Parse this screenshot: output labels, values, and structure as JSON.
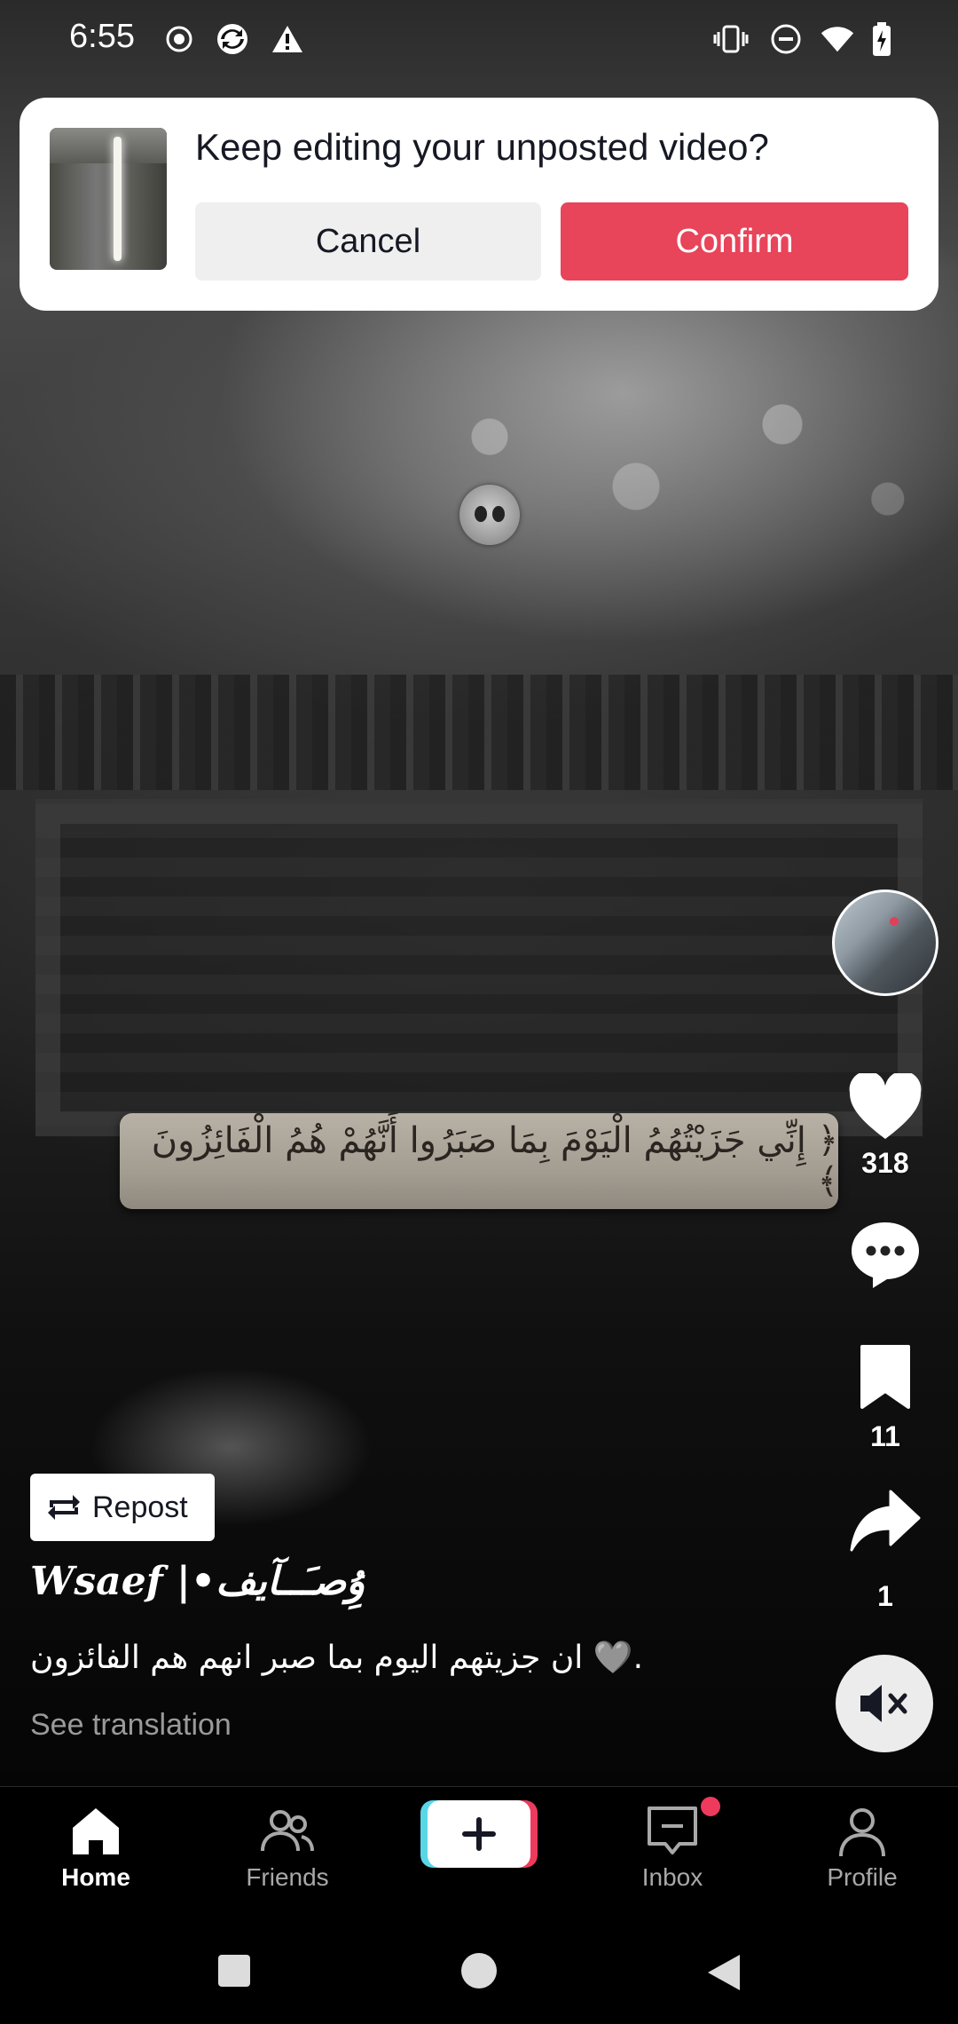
{
  "status_bar": {
    "time": "6:55",
    "left_icons": [
      "record-icon",
      "sync-icon",
      "warning-icon"
    ],
    "right_icons": [
      "vibrate-icon",
      "dnd-icon",
      "wifi-icon",
      "battery-charging-icon"
    ]
  },
  "dialog": {
    "title": "Keep editing your unposted video?",
    "cancel_label": "Cancel",
    "confirm_label": "Confirm",
    "confirm_color": "#e8445a"
  },
  "video": {
    "verse_text": "﴿ إِنِّي جَزَيْتُهُمُ الْيَوْمَ بِمَا صَبَرُوا أَنَّهُمْ هُمُ الْفَائِزُونَ ﴾"
  },
  "rail": {
    "likes": "318",
    "bookmarks": "11",
    "shares": "1"
  },
  "post": {
    "repost_label": "Repost",
    "username": "Wsaef |•ۇِصـَــآيف",
    "caption": "ان جزيتهم اليوم بما صبر انهم هم الفائزون 🩶.",
    "see_translation": "See translation"
  },
  "nav": {
    "home": "Home",
    "friends": "Friends",
    "inbox": "Inbox",
    "profile": "Profile",
    "accent_cyan": "#58d7e7",
    "accent_red": "#ee3a5c"
  }
}
